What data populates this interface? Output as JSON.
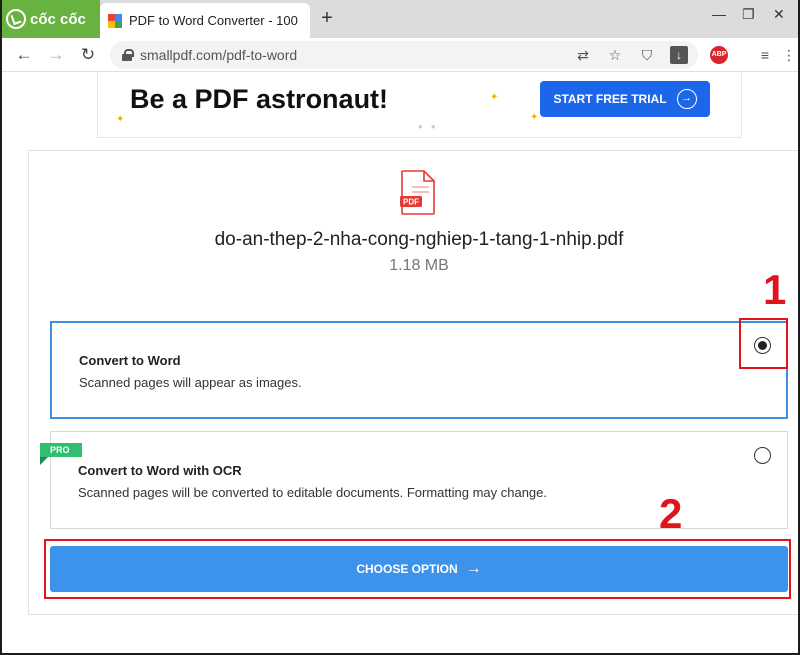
{
  "browser": {
    "logo_text": "cốc cốc",
    "tab_title": "PDF to Word Converter - 100",
    "new_tab": "+",
    "url": "smallpdf.com/pdf-to-word",
    "abp_label": "ABP",
    "controls": {
      "minimize": "—",
      "restore": "❐",
      "close": "✕"
    }
  },
  "ad": {
    "headline": "Be a PDF astronaut!",
    "cta_label": "START FREE TRIAL",
    "cta_arrow": "→"
  },
  "file": {
    "icon_label": "PDF",
    "name": "do-an-thep-2-nha-cong-nghiep-1-tang-1-nhip.pdf",
    "size": "1.18 MB"
  },
  "options": [
    {
      "title": "Convert to Word",
      "description": "Scanned pages will appear as images.",
      "selected": true
    },
    {
      "title": "Convert to Word with OCR",
      "description": "Scanned pages will be converted to editable documents. Formatting may change.",
      "badge": "PRO",
      "selected": false
    }
  ],
  "choose_button": {
    "label": "CHOOSE OPTION",
    "arrow": "→"
  },
  "annotations": {
    "first": "1",
    "second": "2",
    "color": "#e0141b"
  },
  "colors": {
    "accent_blue": "#3d93ec",
    "cta_blue": "#1b66e9",
    "pro_green": "#2fbf71",
    "pdf_red": "#e53935",
    "browser_green": "#68b23f"
  }
}
